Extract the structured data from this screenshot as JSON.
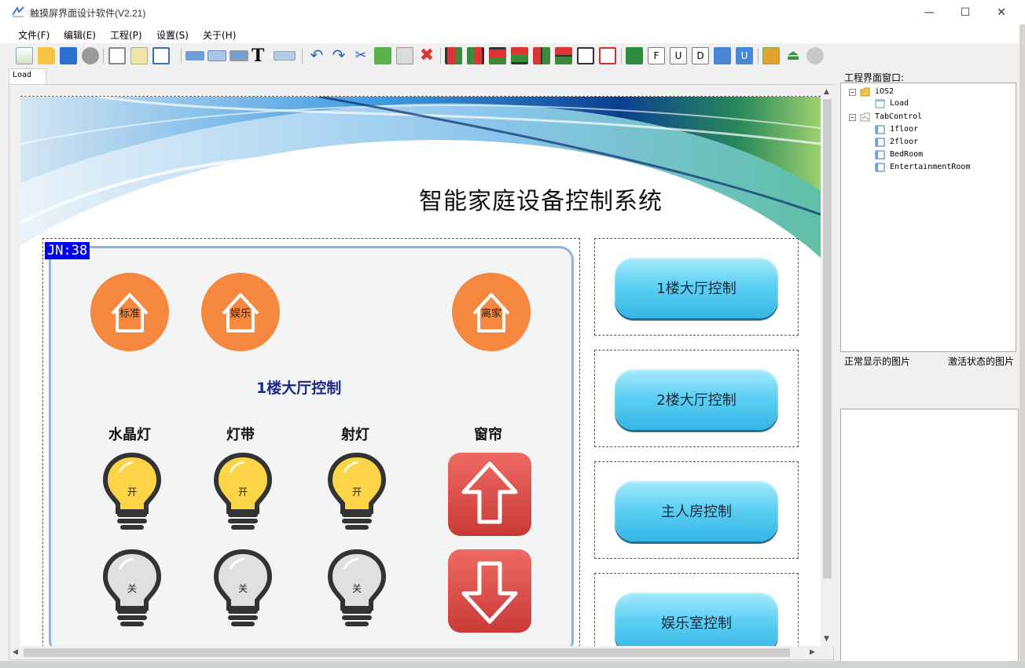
{
  "window": {
    "title": "触摸屏界面设计软件(V2.21)",
    "controls": {
      "minimize": "—",
      "maximize": "☐",
      "close": "✕"
    }
  },
  "menu": {
    "items": [
      "文件(F)",
      "编辑(E)",
      "工程(P)",
      "设置(S)",
      "关于(H)"
    ]
  },
  "toolbar": {
    "icons": [
      "new-page-icon",
      "open-folder-icon",
      "save-icon",
      "settings-gear-icon",
      "window-icon",
      "edit-icon",
      "layout-icon",
      "rect-control-icon",
      "double-rect-icon",
      "image-control-icon",
      "text-tool-icon",
      "graph-icon",
      "undo-icon",
      "redo-icon",
      "cut-icon",
      "copy-icon",
      "paste-icon",
      "delete-icon",
      "align-left-icon",
      "align-right-icon",
      "align-top-icon",
      "align-bottom-icon",
      "align-center-v-icon",
      "align-center-h-icon",
      "same-width-icon",
      "same-height-icon",
      "run-icon",
      "font-icon",
      "upload-icon",
      "download-icon",
      "export-icon",
      "u-download-icon",
      "window-stack-icon",
      "eject-icon",
      "config-gear-icon"
    ]
  },
  "tabs": {
    "active": "Load"
  },
  "canvas": {
    "system_title": "智能家庭设备控制系统",
    "jn_label": "JN:38",
    "scenes": [
      "标准",
      "娱乐",
      "离家"
    ],
    "sub_title": "1楼大厅控制",
    "devices": [
      "水晶灯",
      "灯带",
      "射灯",
      "窗帘"
    ],
    "on_label": "开",
    "off_label": "关",
    "nav_buttons": [
      "1楼大厅控制",
      "2楼大厅控制",
      "主人房控制",
      "娱乐室控制"
    ]
  },
  "project_panel": {
    "label": "工程界面窗口:",
    "tree": {
      "root": "iOS2",
      "root_child": "Load",
      "tab_control": "TabControl",
      "pages": [
        "1floor",
        "2floor",
        "BedRoom",
        "EntertainmentRoom"
      ]
    },
    "normal_image_label": "正常显示的图片",
    "active_image_label": "激活状态的图片"
  },
  "colors": {
    "accent_orange": "#f5883e",
    "bulb_on": "#fcd447",
    "bulb_off": "#e0e0e0",
    "curtain_red": "#e0514c",
    "nav_blue": "#5fd0f3",
    "jn_bg": "#0000ee"
  }
}
